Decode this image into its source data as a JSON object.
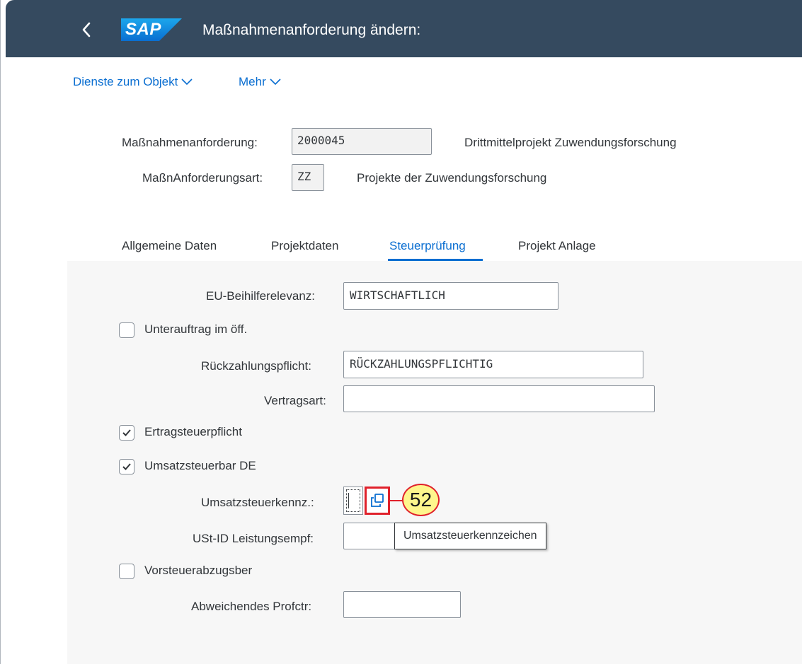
{
  "shell": {
    "logo_text": "SAP",
    "title": "Maßnahmenanforderung ändern:"
  },
  "toolbar": {
    "services_label": "Dienste zum Objekt",
    "more_label": "Mehr"
  },
  "header": {
    "request_label": "Maßnahmenanforderung:",
    "request_value": "2000045",
    "request_desc": "Drittmittelprojekt Zuwendungsforschung",
    "type_label": "MaßnAnforderungsart:",
    "type_value": "ZZ",
    "type_desc": "Projekte der Zuwendungsforschung"
  },
  "tabs": [
    {
      "label": "Allgemeine Daten",
      "active": false
    },
    {
      "label": "Projektdaten",
      "active": false
    },
    {
      "label": "Steuerprüfung",
      "active": true
    },
    {
      "label": "Projekt Anlage",
      "active": false
    }
  ],
  "form": {
    "eu_label": "EU-Beihilferelevanz:",
    "eu_value": "WIRTSCHAFTLICH",
    "subcontract_label": "Unterauftrag im öff.",
    "subcontract_checked": false,
    "repay_label": "Rückzahlungspflicht:",
    "repay_value": "RÜCKZAHLUNGSPFLICHTIG",
    "contract_label": "Vertragsart:",
    "contract_value": "",
    "income_tax_label": "Ertragsteuerpflicht",
    "income_tax_checked": true,
    "vat_label": "Umsatzsteuerbar DE",
    "vat_checked": true,
    "vat_code_label": "Umsatzsteuerkennz.:",
    "vat_code_value": "",
    "vat_id_label": "USt-ID Leistungsempf:",
    "vat_id_value": "",
    "input_tax_label": "Vorsteuerabzugsber",
    "input_tax_checked": false,
    "profit_center_label": "Abweichendes Profctr:",
    "profit_center_value": ""
  },
  "annotation": {
    "step_number": "52",
    "tooltip": "Umsatzsteuerkennzeichen"
  },
  "colors": {
    "shell_bg": "#354a5f",
    "link": "#0a6ed1",
    "highlight": "#e0212b",
    "marker_fill": "#fef68d"
  },
  "icons": {
    "back": "chevron-left-icon",
    "value_help": "value-help-icon",
    "dropdown": "chevron-down-icon",
    "check": "checkmark-icon"
  }
}
